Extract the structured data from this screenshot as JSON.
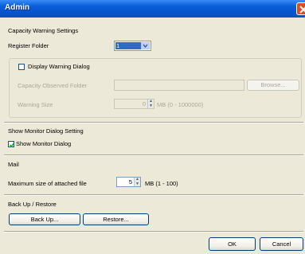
{
  "window": {
    "title": "Admin"
  },
  "capacity": {
    "section_label": "Capacity Warning Settings",
    "register_folder_label": "Register Folder",
    "register_folder_value": "1",
    "display_warning_label": "Display Warning Dialog",
    "display_warning_checked": false,
    "observed_folder_label": "Capacity Observed Folder",
    "observed_folder_value": "",
    "browse_label": "Browse...",
    "warning_size_label": "Warning Size",
    "warning_size_value": "0",
    "warning_size_unit": "MB (0 - 1000000)"
  },
  "monitor": {
    "section_label": "Show Monitor Dialog Setting",
    "show_monitor_label": "Show Monitor Dialog",
    "show_monitor_checked": true
  },
  "mail": {
    "section_label": "Mail",
    "max_size_label": "Maximum size of attached file",
    "max_size_value": "5",
    "max_size_unit": "MB (1 - 100)"
  },
  "backup": {
    "section_label": "Back Up / Restore",
    "backup_label": "Back Up...",
    "restore_label": "Restore..."
  },
  "footer": {
    "ok_label": "OK",
    "cancel_label": "Cancel"
  },
  "colors": {
    "title_bar": "#0a5fd8",
    "dialog_bg": "#ece9d8",
    "select_highlight": "#316ac5"
  },
  "icons": {
    "close": "close-icon",
    "dropdown": "chevron-down-icon",
    "spin_up": "spin-up-icon",
    "spin_down": "spin-down-icon",
    "check": "checkmark-icon"
  }
}
